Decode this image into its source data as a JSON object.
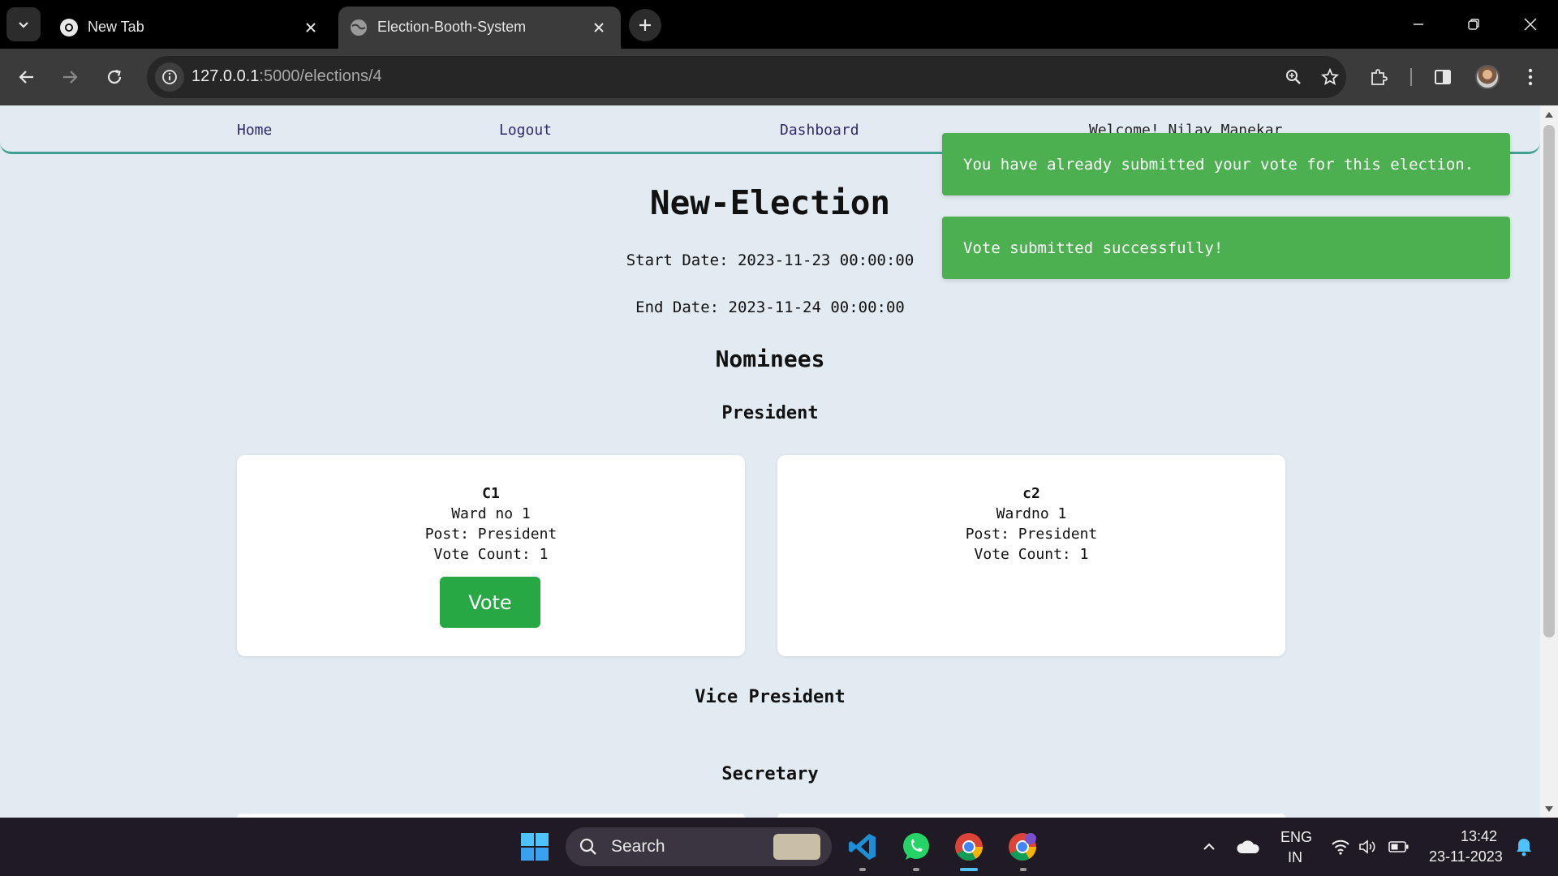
{
  "browser": {
    "tabs": [
      {
        "title": "New Tab",
        "active": false
      },
      {
        "title": "Election-Booth-System",
        "active": true
      }
    ],
    "url_host": "127.0.0.1",
    "url_path": ":5000/elections/4"
  },
  "nav": {
    "home": "Home",
    "logout": "Logout",
    "dashboard": "Dashboard",
    "welcome": "Welcome! Nilay Manekar"
  },
  "election": {
    "title": "New-Election",
    "start_date": "Start Date: 2023-11-23 00:00:00",
    "end_date": "End Date: 2023-11-24 00:00:00",
    "nominees_heading": "Nominees"
  },
  "posts": [
    "President",
    "Vice President",
    "Secretary"
  ],
  "candidates": [
    {
      "name": "C1",
      "ward": "Ward no 1",
      "post": "Post: President",
      "votes": "Vote Count: 1",
      "vote_button": "Vote"
    },
    {
      "name": "c2",
      "ward": "Wardno 1",
      "post": "Post: President",
      "votes": "Vote Count: 1"
    }
  ],
  "toasts": [
    "You have already submitted your vote for this election.",
    "Vote submitted successfully!"
  ],
  "taskbar": {
    "search_label": "Search",
    "language": "ENG",
    "region": "IN",
    "time": "13:42",
    "date": "23-11-2023"
  },
  "colors": {
    "page_bg": "#e2eaf2",
    "nav_border": "#3fa08f",
    "vote_button": "#28a745",
    "toast_bg": "#4caf50"
  },
  "icons": [
    "tab-search-icon",
    "chrome-icon",
    "globe-icon",
    "close-icon",
    "plus-icon",
    "minimize-icon",
    "restore-icon",
    "back-icon",
    "forward-icon",
    "reload-icon",
    "site-info-icon",
    "zoom-icon",
    "star-icon",
    "extensions-icon",
    "side-panel-icon",
    "menu-icon",
    "windows-icon",
    "search-icon",
    "vscode-icon",
    "whatsapp-icon",
    "chevron-up-icon",
    "cloud-icon",
    "wifi-icon",
    "volume-icon",
    "battery-icon",
    "bell-icon"
  ]
}
